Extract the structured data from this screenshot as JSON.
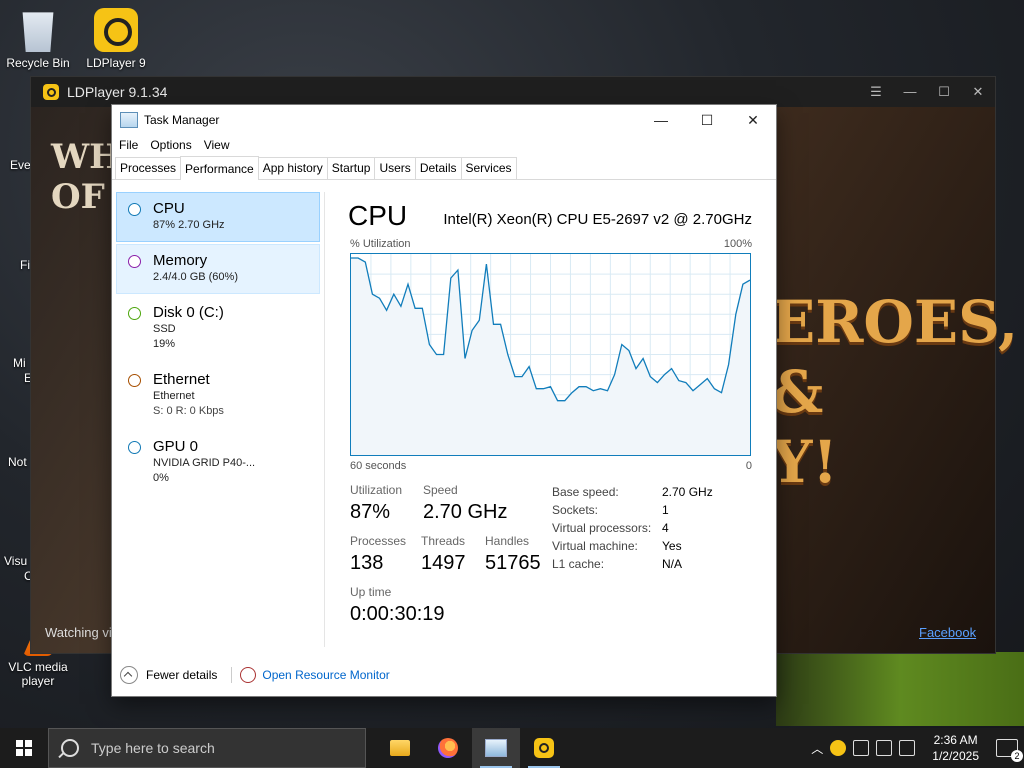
{
  "desktop": {
    "icons": [
      {
        "label": "Recycle Bin"
      },
      {
        "label": "LDPlayer 9"
      },
      {
        "label": "VLC media player"
      }
    ],
    "fragments": [
      "Eve",
      "Fi",
      "Mi",
      "E",
      "Not",
      "Visu",
      "C"
    ]
  },
  "ldplayer": {
    "title": "LDPlayer 9.1.34",
    "game_banner": "EROES,\n&\nY!",
    "game_logo": "WH\nOF S",
    "watching": "Watching vi",
    "facebook": "Facebook",
    "controls": [
      "☰",
      "—",
      "☐",
      "✕"
    ]
  },
  "taskmanager": {
    "title": "Task Manager",
    "menu": [
      "File",
      "Options",
      "View"
    ],
    "tabs": [
      "Processes",
      "Performance",
      "App history",
      "Startup",
      "Users",
      "Details",
      "Services"
    ],
    "active_tab": "Performance",
    "resources": [
      {
        "name": "CPU",
        "sub1": "87%  2.70 GHz",
        "sub2": "",
        "sub3": "",
        "dot": "#1179b5"
      },
      {
        "name": "Memory",
        "sub1": "2.4/4.0 GB (60%)",
        "sub2": "",
        "sub3": "",
        "dot": "#8b1fa9"
      },
      {
        "name": "Disk 0 (C:)",
        "sub1": "SSD",
        "sub2": "19%",
        "sub3": "",
        "dot": "#4da60c"
      },
      {
        "name": "Ethernet",
        "sub1": "Ethernet",
        "sub2": "S: 0  R: 0 Kbps",
        "sub3": "",
        "dot": "#a74f01"
      },
      {
        "name": "GPU 0",
        "sub1": "NVIDIA GRID P40-...",
        "sub2": "0%",
        "sub3": "",
        "dot": "#1179b5"
      }
    ],
    "cpu": {
      "heading": "CPU",
      "model": "Intel(R) Xeon(R) CPU E5-2697 v2 @ 2.70GHz",
      "util_label": "% Utilization",
      "util_max": "100%",
      "time_label": "60 seconds",
      "time_zero": "0",
      "stats": {
        "utilization": {
          "label": "Utilization",
          "value": "87%"
        },
        "speed": {
          "label": "Speed",
          "value": "2.70 GHz"
        },
        "processes": {
          "label": "Processes",
          "value": "138"
        },
        "threads": {
          "label": "Threads",
          "value": "1497"
        },
        "handles": {
          "label": "Handles",
          "value": "51765"
        },
        "uptime": {
          "label": "Up time",
          "value": "0:00:30:19"
        }
      },
      "details": [
        {
          "k": "Base speed:",
          "v": "2.70 GHz"
        },
        {
          "k": "Sockets:",
          "v": "1"
        },
        {
          "k": "Virtual processors:",
          "v": "4"
        },
        {
          "k": "Virtual machine:",
          "v": "Yes"
        },
        {
          "k": "L1 cache:",
          "v": "N/A"
        }
      ],
      "graph_values": [
        98,
        98,
        96,
        80,
        78,
        72,
        80,
        74,
        85,
        73,
        73,
        55,
        50,
        50,
        88,
        92,
        48,
        62,
        67,
        95,
        65,
        65,
        50,
        39,
        39,
        44,
        33,
        33,
        34,
        27,
        27,
        31,
        34,
        34,
        32,
        33,
        32,
        40,
        55,
        52,
        43,
        48,
        39,
        36,
        40,
        43,
        37,
        36,
        32,
        35,
        38,
        33,
        31,
        45,
        70,
        85,
        87
      ]
    },
    "footer": {
      "fewer": "Fewer details",
      "monitor": "Open Resource Monitor"
    }
  },
  "taskbar": {
    "search_placeholder": "Type here to search",
    "time": "2:36 AM",
    "date": "1/2/2025",
    "notifications": "2"
  }
}
